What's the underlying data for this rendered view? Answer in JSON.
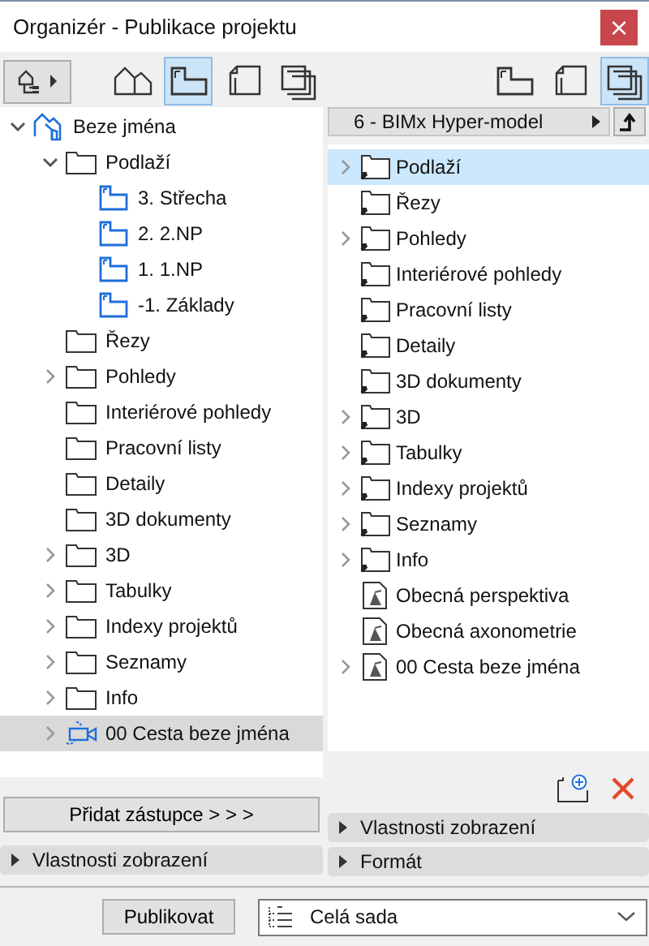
{
  "window": {
    "title": "Organizér - Publikace projektu",
    "close": "×"
  },
  "left": {
    "map_tabs": [
      {
        "kind": "project",
        "selected": false
      },
      {
        "kind": "story",
        "selected": true
      },
      {
        "kind": "layout",
        "selected": false
      },
      {
        "kind": "sets",
        "selected": false
      }
    ],
    "tree": [
      {
        "label": "Beze jména",
        "kind": "project",
        "expanded": true,
        "selected": false,
        "children": [
          {
            "label": "Podlaží",
            "kind": "folder",
            "expanded": true,
            "selected": false,
            "children": [
              {
                "label": "3. Střecha",
                "kind": "story",
                "selected": false
              },
              {
                "label": "2. 2.NP",
                "kind": "story",
                "selected": false
              },
              {
                "label": "1. 1.NP",
                "kind": "story",
                "selected": false
              },
              {
                "label": "-1. Základy",
                "kind": "story",
                "selected": false
              }
            ]
          },
          {
            "label": "Řezy",
            "kind": "folder",
            "selected": false
          },
          {
            "label": "Pohledy",
            "kind": "folder",
            "expanded": false,
            "selected": false
          },
          {
            "label": "Interiérové pohledy",
            "kind": "folder",
            "selected": false
          },
          {
            "label": "Pracovní listy",
            "kind": "folder",
            "selected": false
          },
          {
            "label": "Detaily",
            "kind": "folder",
            "selected": false
          },
          {
            "label": "3D dokumenty",
            "kind": "folder",
            "selected": false
          },
          {
            "label": "3D",
            "kind": "folder",
            "expanded": false,
            "selected": false
          },
          {
            "label": "Tabulky",
            "kind": "folder",
            "expanded": false,
            "selected": false
          },
          {
            "label": "Indexy projektů",
            "kind": "folder",
            "expanded": false,
            "selected": false
          },
          {
            "label": "Seznamy",
            "kind": "folder",
            "expanded": false,
            "selected": false
          },
          {
            "label": "Info",
            "kind": "folder",
            "expanded": false,
            "selected": false
          },
          {
            "label": "00 Cesta beze jména",
            "kind": "camera",
            "expanded": false,
            "selected": true
          }
        ]
      }
    ],
    "add_button": "Přidat zástupce > > >",
    "panels": [
      "Vlastnosti zobrazení"
    ]
  },
  "right": {
    "map_tabs": [
      {
        "kind": "story",
        "selected": false
      },
      {
        "kind": "layout",
        "selected": false
      },
      {
        "kind": "sets",
        "selected": true
      }
    ],
    "publisher_set": "6 - BIMx Hyper-model",
    "tree": [
      {
        "label": "Podlaží",
        "kind": "shortcut",
        "expanded": false,
        "selected": true
      },
      {
        "label": "Řezy",
        "kind": "shortcut",
        "selected": false
      },
      {
        "label": "Pohledy",
        "kind": "shortcut",
        "expanded": false,
        "selected": false
      },
      {
        "label": "Interiérové pohledy",
        "kind": "shortcut",
        "selected": false
      },
      {
        "label": "Pracovní listy",
        "kind": "shortcut",
        "selected": false
      },
      {
        "label": "Detaily",
        "kind": "shortcut",
        "selected": false
      },
      {
        "label": "3D dokumenty",
        "kind": "shortcut",
        "selected": false
      },
      {
        "label": "3D",
        "kind": "shortcut",
        "expanded": false,
        "selected": false
      },
      {
        "label": "Tabulky",
        "kind": "shortcut",
        "expanded": false,
        "selected": false
      },
      {
        "label": "Indexy projektů",
        "kind": "shortcut",
        "expanded": false,
        "selected": false
      },
      {
        "label": "Seznamy",
        "kind": "shortcut",
        "expanded": false,
        "selected": false
      },
      {
        "label": "Info",
        "kind": "shortcut",
        "expanded": false,
        "selected": false
      },
      {
        "label": "Obecná perspektiva",
        "kind": "view",
        "selected": false
      },
      {
        "label": "Obecná axonometrie",
        "kind": "view",
        "selected": false
      },
      {
        "label": "00 Cesta beze jména",
        "kind": "view",
        "expanded": false,
        "selected": false
      }
    ],
    "panels": [
      "Vlastnosti zobrazení",
      "Formát"
    ]
  },
  "footer": {
    "publish_button": "Publikovat",
    "scope": "Celá sada"
  }
}
